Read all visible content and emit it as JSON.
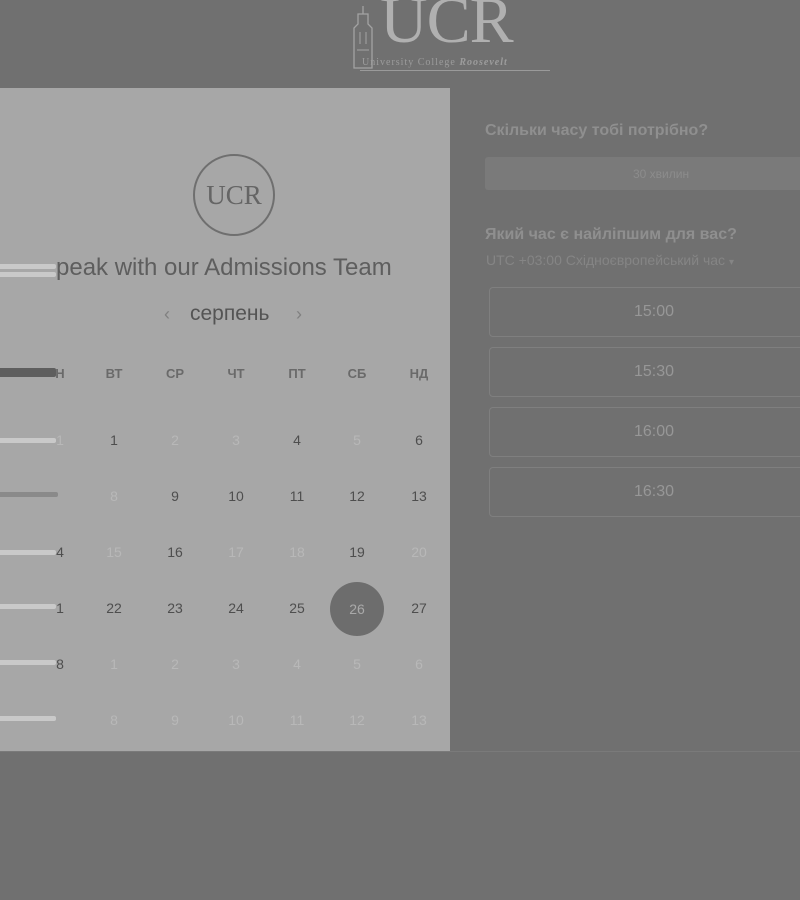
{
  "header": {
    "logo_mark": "UCR",
    "logo_subtitle_plain": "University College ",
    "logo_subtitle_bold": "Roosevelt"
  },
  "calendar": {
    "logo_text": "UCR",
    "title": "peak with our Admissions Team",
    "month": "серпень",
    "prev_icon": "‹",
    "next_icon": "›",
    "weekdays": [
      "Н",
      "ВТ",
      "СР",
      "ЧТ",
      "ПТ",
      "СБ",
      "НД"
    ],
    "rows": [
      [
        {
          "d": "1",
          "off": true
        },
        {
          "d": "1",
          "off": false
        },
        {
          "d": "2",
          "off": true
        },
        {
          "d": "3",
          "off": true
        },
        {
          "d": "4",
          "off": false
        },
        {
          "d": "5",
          "off": true
        },
        {
          "d": "6",
          "off": false
        }
      ],
      [
        {
          "d": "",
          "off": true
        },
        {
          "d": "8",
          "off": true
        },
        {
          "d": "9",
          "off": false
        },
        {
          "d": "10",
          "off": false
        },
        {
          "d": "11",
          "off": false
        },
        {
          "d": "12",
          "off": false
        },
        {
          "d": "13",
          "off": false
        }
      ],
      [
        {
          "d": "4",
          "off": false
        },
        {
          "d": "15",
          "off": true
        },
        {
          "d": "16",
          "off": false
        },
        {
          "d": "17",
          "off": true
        },
        {
          "d": "18",
          "off": true
        },
        {
          "d": "19",
          "off": false
        },
        {
          "d": "20",
          "off": true
        }
      ],
      [
        {
          "d": "1",
          "off": false
        },
        {
          "d": "22",
          "off": false
        },
        {
          "d": "23",
          "off": false
        },
        {
          "d": "24",
          "off": false
        },
        {
          "d": "25",
          "off": false
        },
        {
          "d": "26",
          "off": false,
          "sel": true
        },
        {
          "d": "27",
          "off": false
        }
      ],
      [
        {
          "d": "8",
          "off": false
        },
        {
          "d": "1",
          "off": true
        },
        {
          "d": "2",
          "off": true
        },
        {
          "d": "3",
          "off": true
        },
        {
          "d": "4",
          "off": true
        },
        {
          "d": "5",
          "off": true
        },
        {
          "d": "6",
          "off": true
        }
      ],
      [
        {
          "d": "",
          "off": true
        },
        {
          "d": "8",
          "off": true
        },
        {
          "d": "9",
          "off": true
        },
        {
          "d": "10",
          "off": true
        },
        {
          "d": "11",
          "off": true
        },
        {
          "d": "12",
          "off": true
        },
        {
          "d": "13",
          "off": true
        }
      ]
    ]
  },
  "booking": {
    "duration_question": "Скільки часу тобі потрібно?",
    "duration_value": "30 хвилин",
    "time_question": "Який час є найліпшим для вас?",
    "timezone": "UTC +03:00 Східноєвропейський час",
    "timezone_caret": "▾",
    "slots": [
      "15:00",
      "15:30",
      "16:00",
      "16:30"
    ]
  }
}
